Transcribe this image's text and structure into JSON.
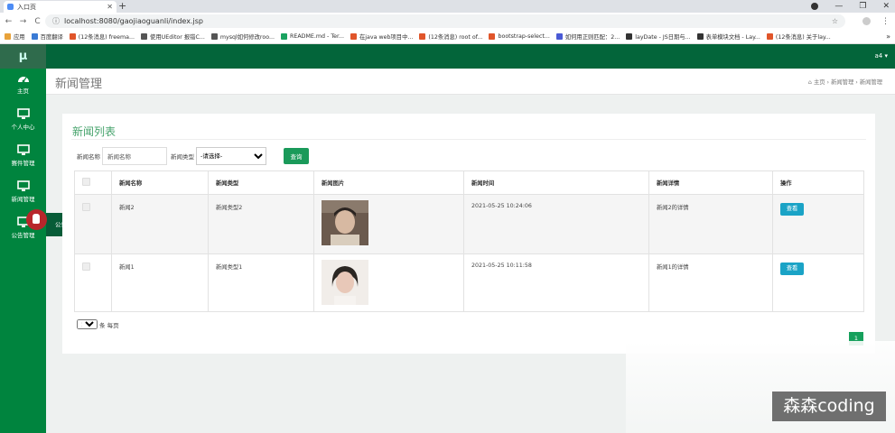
{
  "browser": {
    "tab_title": "入口页",
    "url": "localhost:8080/gaojiaoguanli/index.jsp",
    "bookmarks": [
      {
        "label": "应用",
        "color": "#e8a23a"
      },
      {
        "label": "百度翻译",
        "color": "#3a7bd5"
      },
      {
        "label": "(12条消息) freema...",
        "color": "#e0552a"
      },
      {
        "label": "使用UEditor 报错C...",
        "color": "#555555"
      },
      {
        "label": "mysql如何修改roo...",
        "color": "#555555"
      },
      {
        "label": "README.md - Ter...",
        "color": "#1aa260"
      },
      {
        "label": "在java web项目中...",
        "color": "#e0552a"
      },
      {
        "label": "(12条消息) root of...",
        "color": "#e0552a"
      },
      {
        "label": "bootstrap-select...",
        "color": "#e0552a"
      },
      {
        "label": "如何用正则匹配：2...",
        "color": "#4a5ad5"
      },
      {
        "label": "layDate - JS日期与...",
        "color": "#333333"
      },
      {
        "label": "表单模块文档 - Lay...",
        "color": "#333333"
      },
      {
        "label": "(12条消息) 关于lay...",
        "color": "#e0552a"
      }
    ]
  },
  "sidebar": {
    "logo": "μ",
    "items": [
      {
        "label": "主页",
        "icon": "dashboard-icon"
      },
      {
        "label": "个人中心",
        "icon": "monitor-icon"
      },
      {
        "label": "赛件管理",
        "icon": "monitor-icon"
      },
      {
        "label": "新闻管理",
        "icon": "monitor-icon"
      },
      {
        "label": "公告管理",
        "icon": "monitor-icon"
      }
    ],
    "flyout_label": "公告管理"
  },
  "topbar": {
    "user": "a4 ▾"
  },
  "page": {
    "title": "新闻管理",
    "breadcrumb": [
      "主页",
      "新闻管理",
      "新闻管理"
    ]
  },
  "card": {
    "title": "新闻列表",
    "form": {
      "name_label": "新闻名称",
      "name_placeholder": "新闻名称",
      "type_label": "新闻类型",
      "type_selected": "-请选择-",
      "query_button": "查询"
    },
    "columns": [
      "",
      "新闻名称",
      "新闻类型",
      "新闻图片",
      "新闻时间",
      "新闻详情",
      "操作"
    ],
    "rows": [
      {
        "name": "新闻2",
        "type": "新闻类型2",
        "time": "2021-05-25 10:24:06",
        "detail": "新闻2的详情",
        "action": "查看",
        "thumb_colors": [
          "#6b5a4e",
          "#d7b9a2",
          "#2a2320"
        ]
      },
      {
        "name": "新闻1",
        "type": "新闻类型1",
        "time": "2021-05-25 10:11:58",
        "detail": "新闻1的详情",
        "action": "查看",
        "thumb_colors": [
          "#f1ede9",
          "#e8c8b8",
          "#2b2622"
        ]
      }
    ],
    "pager": {
      "page_size": "10",
      "page_size_suffix": "条 每页",
      "current_page": "1"
    }
  },
  "watermark": "森森coding"
}
